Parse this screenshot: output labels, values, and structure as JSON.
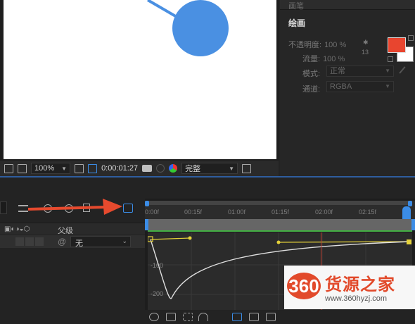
{
  "viewer": {
    "toolbar": {
      "zoom": "100%",
      "timecode": "0:00:01:27",
      "quality": "完整"
    }
  },
  "paint_panel": {
    "header": "画笔",
    "title": "绘画",
    "opacity_label": "不透明度:",
    "opacity_value": "100 %",
    "flow_label": "流量:",
    "flow_value": "100 %",
    "brush_size": "13",
    "mode_label": "模式:",
    "mode_value": "正常",
    "channel_label": "通道:",
    "channel_value": "RGBA",
    "fg_color": "#e8452f",
    "bg_color": "#ffffff"
  },
  "timeline": {
    "parent_header": "父级",
    "parent_value": "无",
    "ruler_ticks": [
      "0:00f",
      "00:15f",
      "01:00f",
      "01:15f",
      "02:00f",
      "02:15f"
    ],
    "graph_labels": [
      "-100",
      "-200"
    ],
    "accent_color": "#3b8ce6",
    "annotation_arrow_color": "#e64a2e"
  },
  "watermark": {
    "logo": "360",
    "name": "货源之家",
    "url": "www.360hyzj.com"
  }
}
